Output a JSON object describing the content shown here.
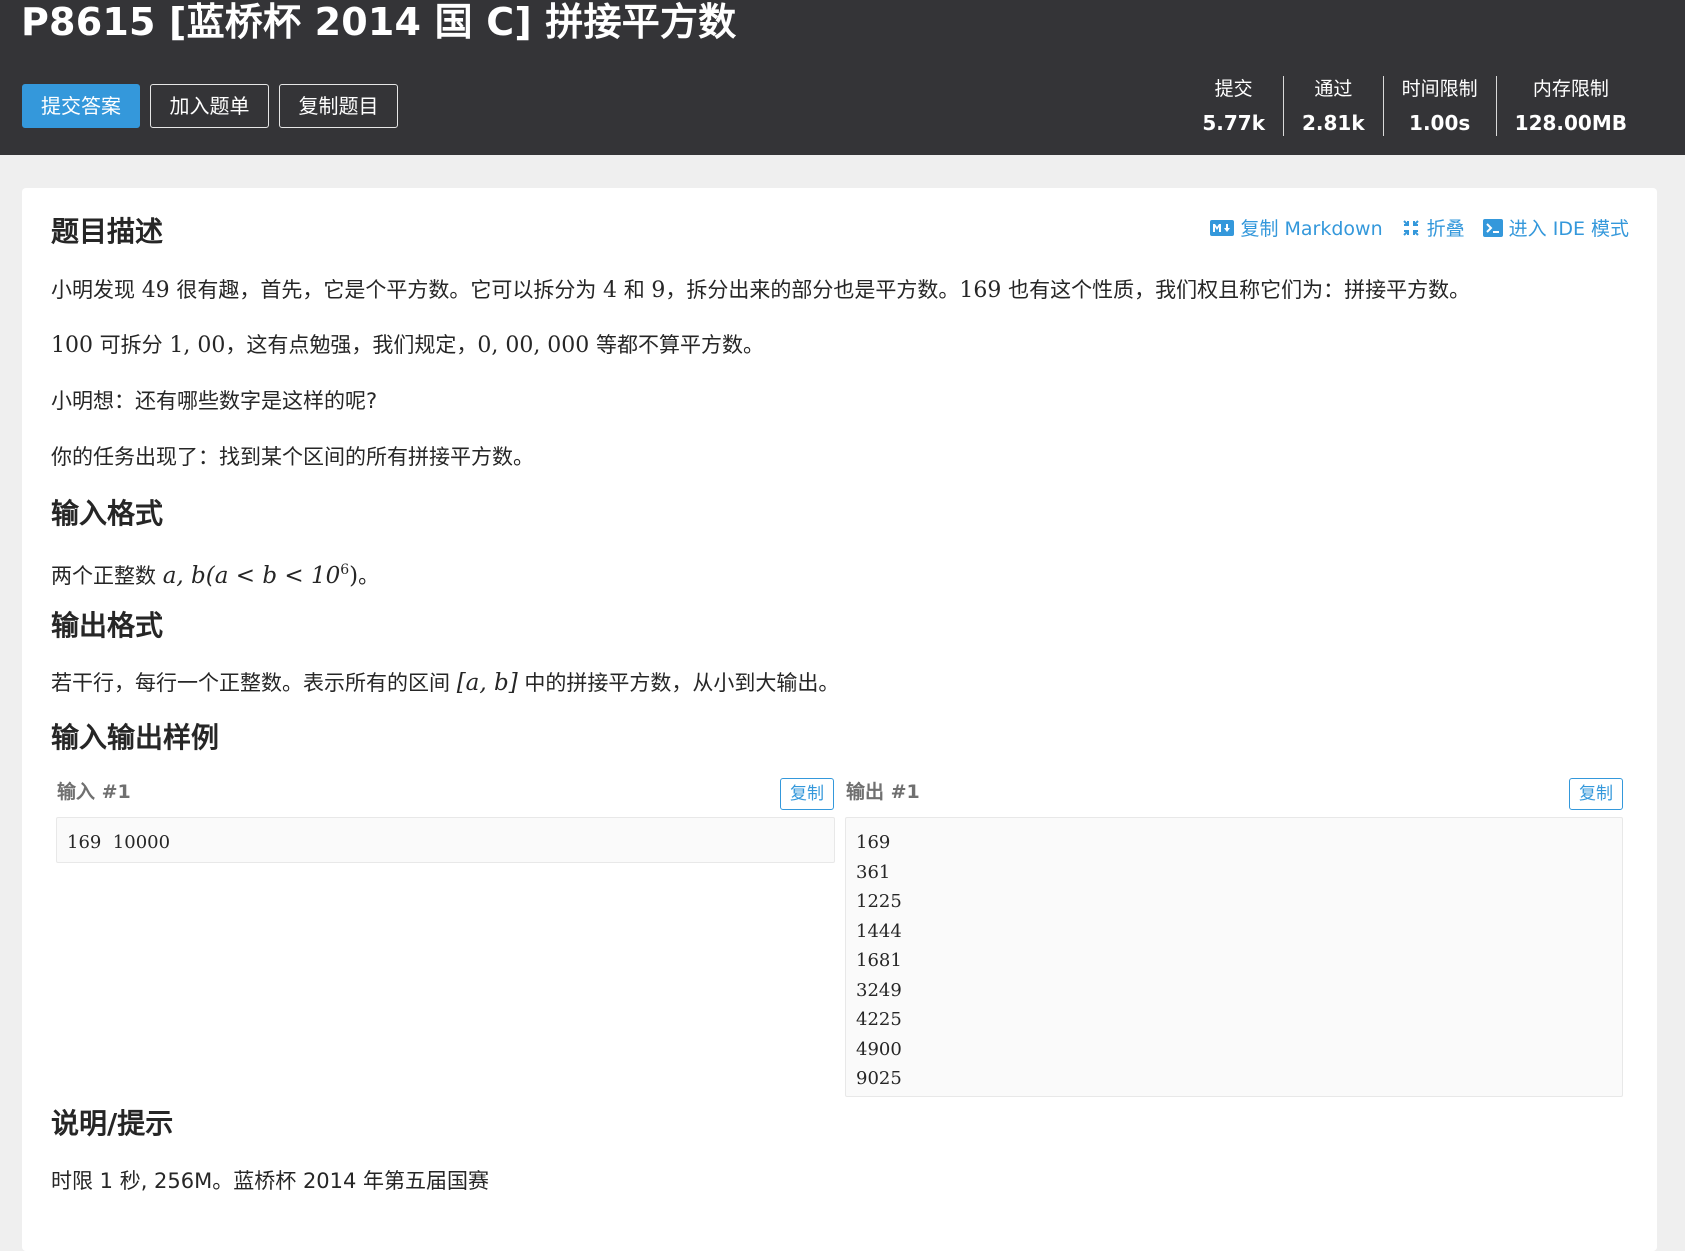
{
  "header": {
    "title": "P8615 [蓝桥杯 2014 国 C] 拼接平方数",
    "buttons": {
      "submit": "提交答案",
      "add_to_list": "加入题单",
      "copy_problem": "复制题目"
    },
    "stats": [
      {
        "label": "提交",
        "value": "5.77k"
      },
      {
        "label": "通过",
        "value": "2.81k"
      },
      {
        "label": "时间限制",
        "value": "1.00s"
      },
      {
        "label": "内存限制",
        "value": "128.00MB"
      }
    ]
  },
  "toolbar": {
    "copy_markdown": "复制 Markdown",
    "fold": "折叠",
    "ide_mode": "进入 IDE 模式"
  },
  "description": {
    "heading": "题目描述",
    "p1": {
      "a": "小明发现 ",
      "n1": "49",
      "b": " 很有趣，首先，它是个平方数。它可以拆分为 ",
      "n2": "4",
      "c": " 和 ",
      "n3": "9",
      "d": "，拆分出来的部分也是平方数。",
      "n4": "169",
      "e": " 也有这个性质，我们权且称它们为：拼接平方数。"
    },
    "p2": {
      "n1": "100",
      "a": " 可拆分 ",
      "n2": "1, 00",
      "b": "，这有点勉强，我们规定，",
      "n3": "0, 00, 000",
      "c": " 等都不算平方数。"
    },
    "p3": "小明想：还有哪些数字是这样的呢?",
    "p4": "你的任务出现了：找到某个区间的所有拼接平方数。"
  },
  "input_format": {
    "heading": "输入格式",
    "prefix": "两个正整数 ",
    "math_a": "a, b(a < b < 10",
    "math_exp": "6",
    "math_close": ")",
    "suffix": "。"
  },
  "output_format": {
    "heading": "输出格式",
    "prefix": "若干行，每行一个正整数。表示所有的区间 ",
    "math": "[a, b]",
    "suffix": " 中的拼接平方数，从小到大输出。"
  },
  "samples": {
    "heading": "输入输出样例",
    "input_label": "输入 #1",
    "output_label": "输出 #1",
    "copy_label": "复制",
    "input_value": "169  10000",
    "output_lines": [
      "169",
      "361",
      "1225",
      "1444",
      "1681",
      "3249",
      "4225",
      "4900",
      "9025"
    ]
  },
  "hint": {
    "heading": "说明/提示",
    "text": "时限 1 秒, 256M。蓝桥杯 2014 年第五届国赛"
  },
  "colors": {
    "header_bg": "#343437",
    "accent": "#3498db",
    "page_bg": "#efefef"
  }
}
